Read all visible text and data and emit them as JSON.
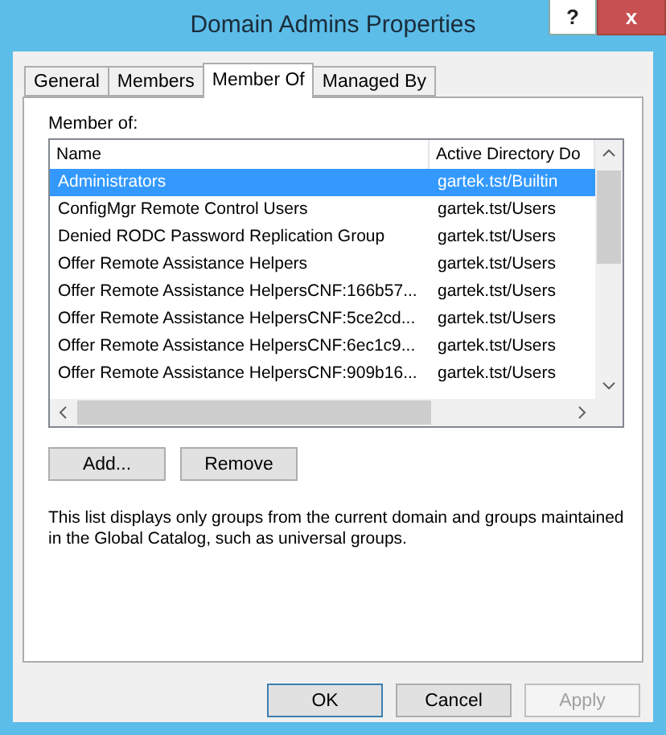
{
  "window": {
    "title": "Domain Admins Properties",
    "help_button": "?",
    "close_button": "x"
  },
  "tabs": [
    {
      "label": "General",
      "selected": false
    },
    {
      "label": "Members",
      "selected": false
    },
    {
      "label": "Member Of",
      "selected": true
    },
    {
      "label": "Managed By",
      "selected": false
    }
  ],
  "member_of": {
    "label": "Member of:",
    "columns": [
      "Name",
      "Active Directory Do"
    ],
    "rows": [
      {
        "name": "Administrators",
        "folder": "gartek.tst/Builtin",
        "selected": true
      },
      {
        "name": "ConfigMgr Remote Control Users",
        "folder": "gartek.tst/Users",
        "selected": false
      },
      {
        "name": "Denied RODC Password Replication Group",
        "folder": "gartek.tst/Users",
        "selected": false
      },
      {
        "name": "Offer Remote Assistance Helpers",
        "folder": "gartek.tst/Users",
        "selected": false
      },
      {
        "name": "Offer Remote Assistance HelpersCNF:166b57...",
        "folder": "gartek.tst/Users",
        "selected": false
      },
      {
        "name": "Offer Remote Assistance HelpersCNF:5ce2cd...",
        "folder": "gartek.tst/Users",
        "selected": false
      },
      {
        "name": "Offer Remote Assistance HelpersCNF:6ec1c9...",
        "folder": "gartek.tst/Users",
        "selected": false
      },
      {
        "name": "Offer Remote Assistance HelpersCNF:909b16...",
        "folder": "gartek.tst/Users",
        "selected": false
      }
    ]
  },
  "actions": [
    {
      "label": "Add..."
    },
    {
      "label": "Remove"
    }
  ],
  "note": "This list displays only groups from the current domain and groups maintained in the Global Catalog, such as universal groups.",
  "buttons": [
    {
      "label": "OK",
      "disabled": false
    },
    {
      "label": "Cancel",
      "disabled": false
    },
    {
      "label": "Apply",
      "disabled": true
    }
  ]
}
